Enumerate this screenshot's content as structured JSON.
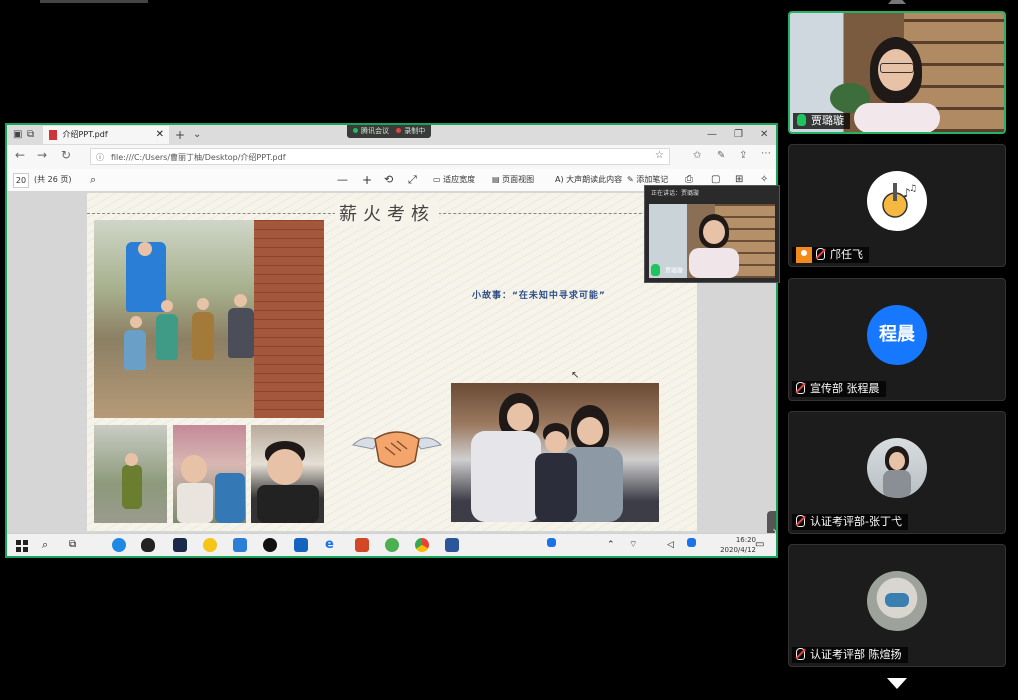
{
  "meeting": {
    "share_banner_left": "腾讯会议",
    "share_banner_right": "录制中"
  },
  "browser": {
    "tab_title": "介绍PPT.pdf",
    "tab_close": "✕",
    "new_tab": "+",
    "url": "file:///C:/Users/曹丽丁柚/Desktop/介绍PPT.pdf"
  },
  "pdf_toolbar": {
    "page_number": "20",
    "page_total": "(共 26 页)",
    "fit": "适应宽度",
    "page_view": "页面视图",
    "read_aloud": "大声朗读此内容",
    "draw": "添加笔记"
  },
  "slide": {
    "title": "薪火考核",
    "subtitle": "小故事：“在未知中寻求可能”"
  },
  "floating_cam": {
    "header": "正在讲话：贾璐璇",
    "caption": "贾璐璇"
  },
  "taskbar": {
    "time": "16:20",
    "date": "2020/4/12"
  },
  "participants": [
    {
      "name": "贾璐璇",
      "mic": "on",
      "active": true
    },
    {
      "name": "邝任飞",
      "mic": "muted",
      "active": false
    },
    {
      "name": "宣传部 张程晨",
      "mic": "muted",
      "active": false,
      "avatar_text": "程晨"
    },
    {
      "name": "认证考评部-张丁弋",
      "mic": "muted",
      "active": false
    },
    {
      "name": "认证考评部 陈煊扬",
      "mic": "muted",
      "active": false
    }
  ],
  "colors": {
    "active_border": "#27b262",
    "avatar_blue": "#1677ff",
    "share_border": "#19a35c",
    "slide_subtitle": "#2e4e88"
  }
}
